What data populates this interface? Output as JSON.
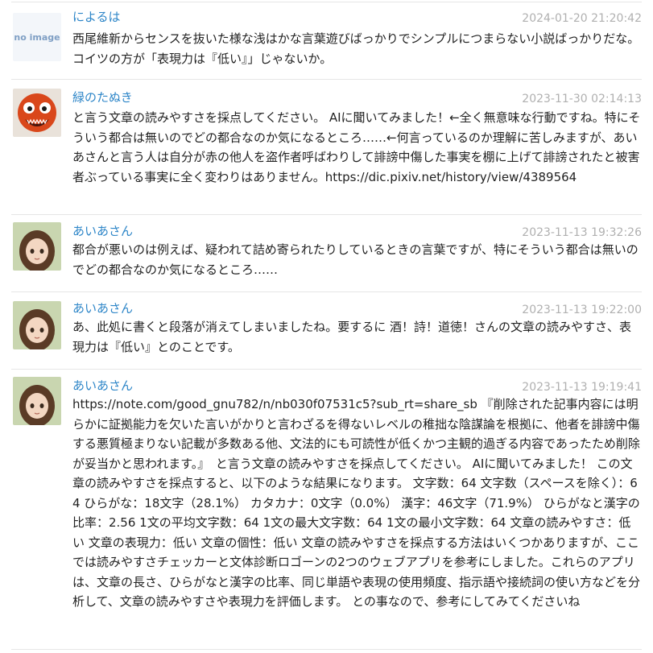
{
  "comments": [
    {
      "name": "によるは",
      "timestamp": "2024-01-20 21:20:42",
      "avatar": "no-image",
      "avatar_text": "no image",
      "body": "西尾維新からセンスを抜いた様な浅はかな言葉遊びばっかりでシンプルにつまらない小説ばっかりだな。コイツの方が「表現力は『低い』」じゃないか。"
    },
    {
      "name": "緑のたぬき",
      "timestamp": "2023-11-30 02:14:13",
      "avatar": "orange-monster",
      "body": "と言う文章の読みやすさを採点してください。 AIに聞いてみました！←全く無意味な行動ですね。特にそういう都合は無いのでどの都合なのか気になるところ……←何言っているのか理解に苦しみますが、あいあさんと言う人は自分が赤の他人を盗作者呼ばわりして誹謗中傷した事実を棚に上げて誹謗されたと被害者ぶっている事実に全く変わりはありません。https://dic.pixiv.net/history/view/4389564"
    },
    {
      "name": "あいあさん",
      "timestamp": "2023-11-13 19:32:26",
      "avatar": "anime-girl",
      "body": "都合が悪いのは例えば、疑われて詰め寄られたりしているときの言葉ですが、特にそういう都合は無いのでどの都合なのか気になるところ……"
    },
    {
      "name": "あいあさん",
      "timestamp": "2023-11-13 19:22:00",
      "avatar": "anime-girl",
      "body": "あ、此処に書くと段落が消えてしまいましたね。要するに 酒！詩！道徳！さんの文章の読みやすさ、表現力は『低い』とのことです。"
    },
    {
      "name": "あいあさん",
      "timestamp": "2023-11-13 19:19:41",
      "avatar": "anime-girl",
      "body": "https://note.com/good_gnu782/n/nb030f07531c5?sub_rt=share_sb 『削除された記事内容には明らかに証拠能力を欠いた言いがかりと言わざるを得ないレベルの稚拙な陰謀論を根拠に、他者を誹謗中傷する悪質極まりない記載が多数ある他、文法的にも可読性が低くかつ主観的過ぎる内容であったため削除が妥当かと思われます。』　と言う文章の読みやすさを採点してください。 AIに聞いてみました！ この文章の読みやすさを採点すると、以下のような結果になります。 文字数：64 文字数（スペースを除く）：64 ひらがな：18文字（28.1%） カタカナ：0文字（0.0%） 漢字：46文字（71.9%） ひらがなと漢字の比率：2.56 1文の平均文字数：64 1文の最大文字数：64 1文の最小文字数：64 文章の読みやすさ：低い 文章の表現力：低い 文章の個性：低い 文章の読みやすさを採点する方法はいくつかありますが、ここでは読みやすさチェッカーと文体診断ロゴーンの2つのウェブアプリを参考にしました。これらのアプリは、文章の長さ、ひらがなと漢字の比率、同じ単語や表現の使用頻度、指示語や接続詞の使い方などを分析して、文章の読みやすさや表現力を評価します。 との事なので、参考にしてみてくださいね"
    }
  ]
}
